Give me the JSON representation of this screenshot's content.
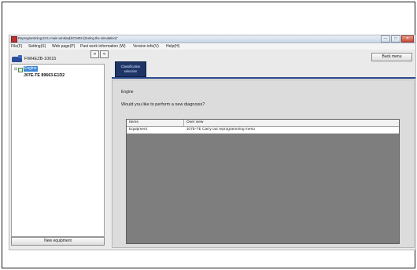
{
  "window": {
    "title": "Reprogramming ECU main window[SC0402-(During the simulation)\"",
    "buttons": [
      "—",
      "□",
      "✕"
    ]
  },
  "menu": {
    "items": [
      "File(F)",
      "Setting(S)",
      "Web page(P)",
      "Past work information (W)",
      "Version info(V)",
      "Help(H)"
    ]
  },
  "toolbar": {
    "back_label": "Back menu",
    "nav_collapse": "«",
    "nav_next": "»"
  },
  "vehicle": {
    "label": "FWHEZB-10015"
  },
  "tree": {
    "toggle": "⊟",
    "engine_label": "Engine",
    "ecu_label": "J07E-TE 89663-E1D2"
  },
  "new_equipment_label": "New equipment",
  "classification": {
    "line1": "Classification",
    "line2": "selection"
  },
  "main": {
    "section_title": "Engine",
    "question": "Would you like to perform a new diagnosis?"
  },
  "table": {
    "headers": [
      "Items",
      "Over view"
    ],
    "rows": [
      {
        "item": "Equipment",
        "overview": "J07E-TE Carry out reprogramming menu"
      }
    ]
  }
}
